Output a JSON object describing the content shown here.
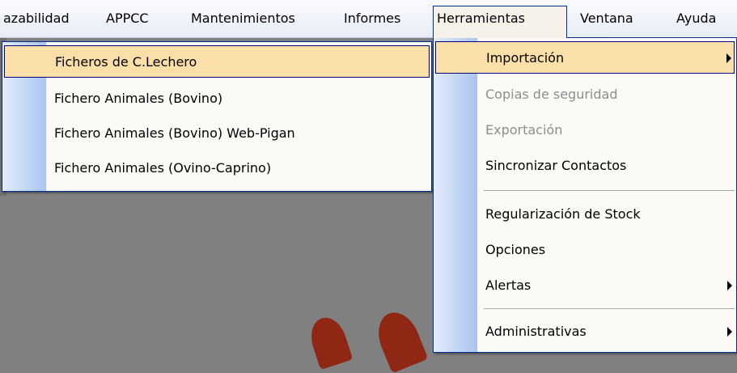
{
  "menubar": {
    "items": [
      {
        "label": "azabilidad"
      },
      {
        "label": "APPCC"
      },
      {
        "label": "Mantenimientos"
      },
      {
        "label": "Informes"
      },
      {
        "label": "Herramientas"
      },
      {
        "label": "Ventana"
      },
      {
        "label": "Ayuda"
      }
    ]
  },
  "submenu_importacion": {
    "items": [
      {
        "label": "Ficheros de C.Lechero"
      },
      {
        "label": "Fichero Animales (Bovino)"
      },
      {
        "label": "Fichero Animales (Bovino) Web-Pigan"
      },
      {
        "label": "Fichero Animales (Ovino-Caprino)"
      }
    ]
  },
  "menu_herramientas": {
    "items": [
      {
        "label": "Importación"
      },
      {
        "label": "Copias de seguridad"
      },
      {
        "label": "Exportación"
      },
      {
        "label": "Sincronizar Contactos"
      },
      {
        "label": "Regularización de Stock"
      },
      {
        "label": "Opciones"
      },
      {
        "label": "Alertas"
      },
      {
        "label": "Administrativas"
      }
    ]
  },
  "colors": {
    "menu_border": "#002d96",
    "highlight": "#fbdfa8",
    "gutter": "#a9c4ef",
    "disabled_text": "#8d8d8d"
  }
}
